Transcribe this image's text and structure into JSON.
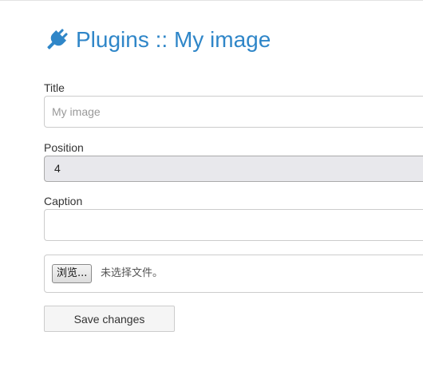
{
  "header": {
    "icon": "plug-icon",
    "title": "Plugins :: My image",
    "accent_color": "#2f86c8"
  },
  "form": {
    "title_field": {
      "label": "Title",
      "value": "",
      "placeholder": "My image"
    },
    "position_field": {
      "label": "Position",
      "selected": "4"
    },
    "caption_field": {
      "label": "Caption",
      "value": "",
      "placeholder": ""
    },
    "file_field": {
      "browse_label": "浏览...",
      "status_text": "未选择文件。"
    },
    "save_label": "Save changes"
  }
}
